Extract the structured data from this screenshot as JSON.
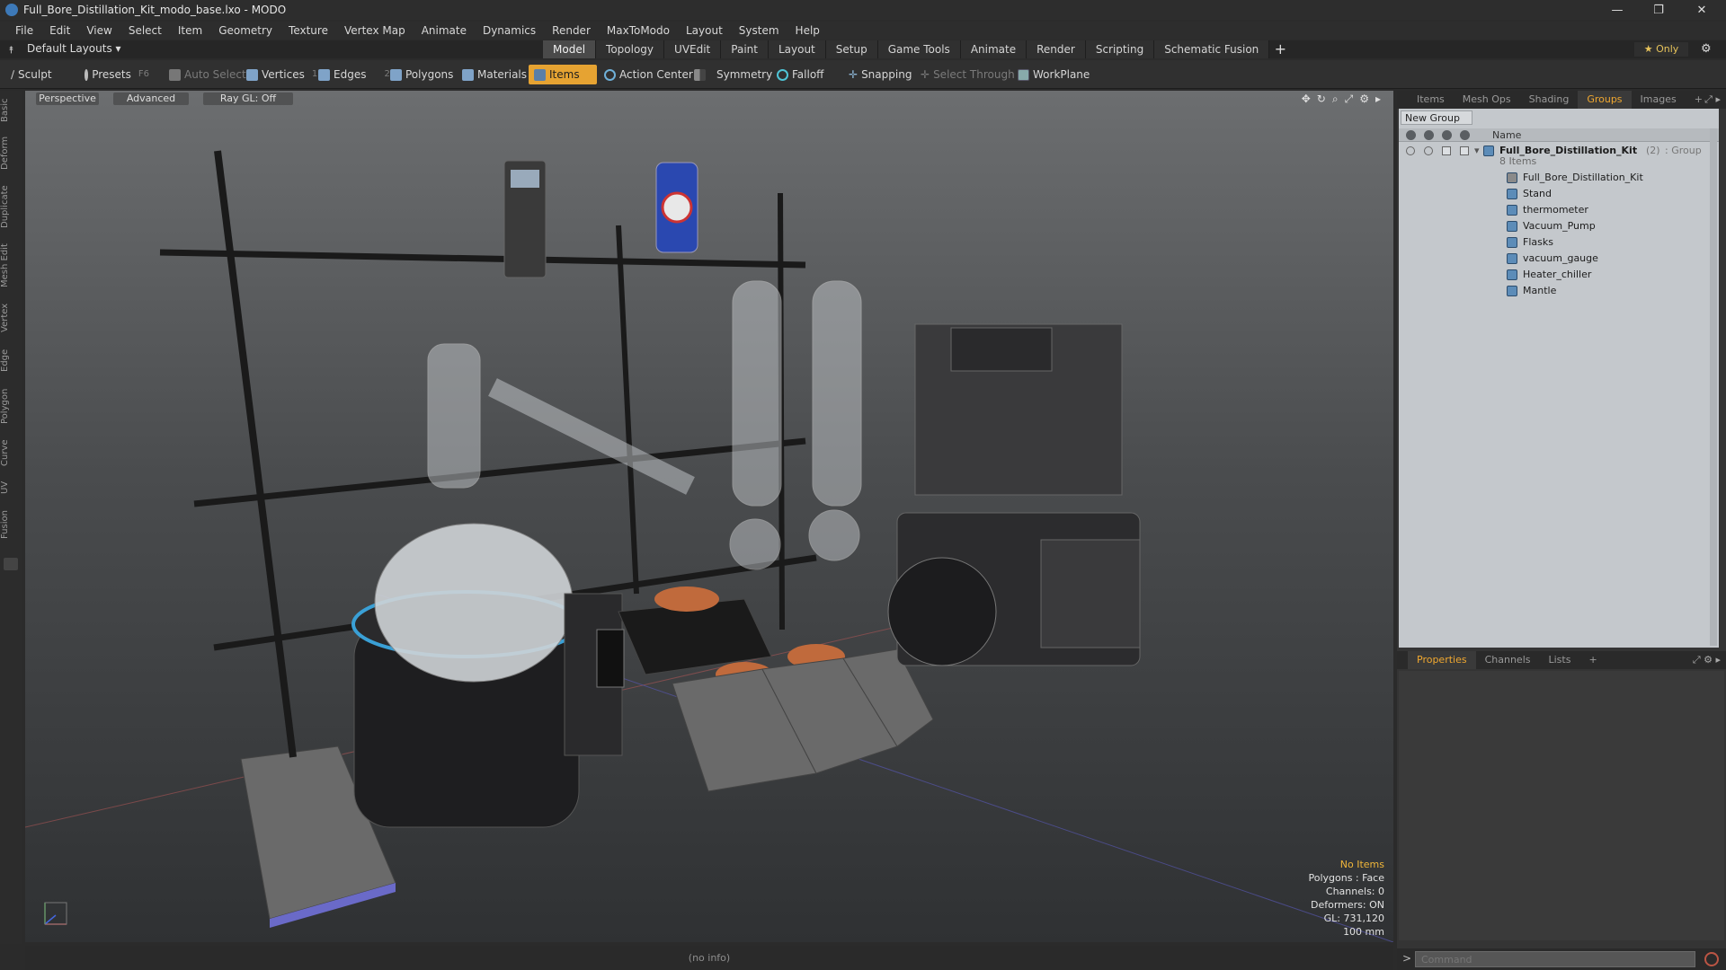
{
  "window": {
    "title": "Full_Bore_Distillation_Kit_modo_base.lxo - MODO",
    "controls": [
      "—",
      "❐",
      "✕"
    ]
  },
  "menu": [
    "File",
    "Edit",
    "View",
    "Select",
    "Item",
    "Geometry",
    "Texture",
    "Vertex Map",
    "Animate",
    "Dynamics",
    "Render",
    "MaxToModo",
    "Layout",
    "System",
    "Help"
  ],
  "layout_selector": "Default Layouts ▾",
  "tabs": [
    {
      "label": "Model",
      "active": true
    },
    {
      "label": "Topology",
      "active": false
    },
    {
      "label": "UVEdit",
      "active": false
    },
    {
      "label": "Paint",
      "active": false
    },
    {
      "label": "Layout",
      "active": false
    },
    {
      "label": "Setup",
      "active": false
    },
    {
      "label": "Game Tools",
      "active": false
    },
    {
      "label": "Animate",
      "active": false
    },
    {
      "label": "Render",
      "active": false
    },
    {
      "label": "Scripting",
      "active": false
    },
    {
      "label": "Schematic Fusion",
      "active": false
    }
  ],
  "tab_add": "+",
  "only_button": "★  Only",
  "toolbar": {
    "sculpt": "Sculpt",
    "presets": "Presets",
    "presets_key": "F6",
    "auto_select": "Auto Select",
    "vertices": "Vertices",
    "vertices_count": "1",
    "edges": "Edges",
    "edges_count": "2",
    "polygons": "Polygons",
    "materials": "Materials",
    "items": "Items",
    "action_center": "Action Center",
    "symmetry": "Symmetry",
    "falloff": "Falloff",
    "snapping": "Snapping",
    "select_through": "Select Through",
    "workplane": "WorkPlane"
  },
  "left_tabs": [
    "Basic",
    "Deform",
    "Duplicate",
    "Mesh Edit",
    "Vertex",
    "Edge",
    "Polygon",
    "Curve",
    "UV",
    "Fusion"
  ],
  "viewport": {
    "view": "Perspective",
    "shading": "Advanced",
    "raygl": "Ray GL: Off",
    "info": {
      "selection": "No Items",
      "polygons": "Polygons : Face",
      "channels": "Channels: 0",
      "deformers": "Deformers: ON",
      "gl": "GL: 731,120",
      "scale": "100 mm"
    }
  },
  "status_bar": "(no info)",
  "right_panel": {
    "top_tabs": [
      {
        "label": "Items",
        "active": false
      },
      {
        "label": "Mesh Ops",
        "active": false
      },
      {
        "label": "Shading",
        "active": false
      },
      {
        "label": "Groups",
        "active": true
      },
      {
        "label": "Images",
        "active": false
      }
    ],
    "new_group": "New Group",
    "name_column": "Name",
    "group": {
      "name": "Full_Bore_Distillation_Kit",
      "count": "(2)",
      "type": ": Group",
      "items_count": "8 Items"
    },
    "children": [
      "Full_Bore_Distillation_Kit",
      "Stand",
      "thermometer",
      "Vacuum_Pump",
      "Flasks",
      "vacuum_gauge",
      "Heater_chiller",
      "Mantle"
    ],
    "bottom_tabs": [
      {
        "label": "Properties",
        "active": true
      },
      {
        "label": "Channels",
        "active": false
      },
      {
        "label": "Lists",
        "active": false
      }
    ],
    "command_placeholder": "Command",
    "command_prompt": ">"
  },
  "colors": {
    "accent": "#e6a332",
    "active_tab_text": "#f0a830",
    "viewport_top": "#6c6e70",
    "viewport_bottom": "#2f3133"
  }
}
